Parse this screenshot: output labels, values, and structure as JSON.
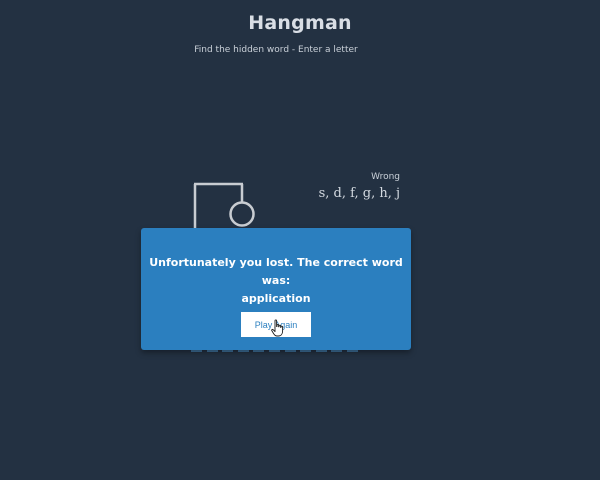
{
  "header": {
    "title": "Hangman",
    "subtitle": "Find the hidden word - Enter a letter"
  },
  "wrong": {
    "label": "Wrong",
    "letters": "s, d, f, g, h, j"
  },
  "word": {
    "slot_count": 11
  },
  "modal": {
    "message_line1": "Unfortunately you lost. The correct word was:",
    "message_line2": "application",
    "play_again_label": "Play Again"
  },
  "colors": {
    "background": "#233142",
    "modal": "#2b7fbf",
    "figure_stroke": "#c8ccd1"
  }
}
